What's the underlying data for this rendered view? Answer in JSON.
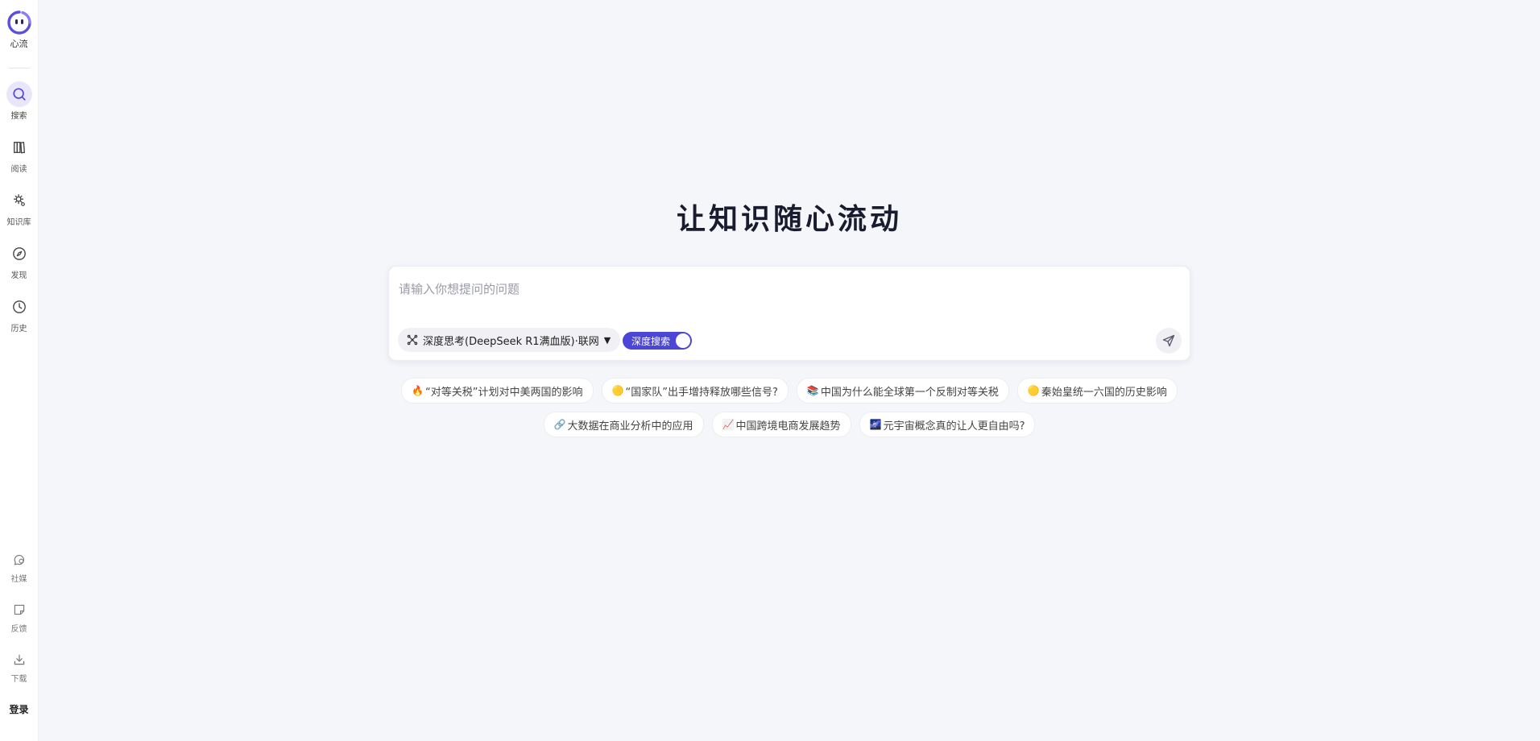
{
  "brand": {
    "name": "心流"
  },
  "sidebar": {
    "items": [
      {
        "label": "搜索",
        "icon": "search-icon",
        "active": true
      },
      {
        "label": "阅读",
        "icon": "book-icon",
        "active": false
      },
      {
        "label": "知识库",
        "icon": "knowledge-icon",
        "active": false
      },
      {
        "label": "发现",
        "icon": "compass-icon",
        "active": false
      },
      {
        "label": "历史",
        "icon": "clock-icon",
        "active": false
      }
    ],
    "bottom_items": [
      {
        "label": "社媒",
        "icon": "chat-icon"
      },
      {
        "label": "反馈",
        "icon": "note-icon"
      },
      {
        "label": "下载",
        "icon": "download-icon"
      }
    ],
    "login_label": "登录"
  },
  "main": {
    "headline": "让知识随心流动",
    "search": {
      "placeholder": "请输入你想提问的问题",
      "model_label": "深度思考(DeepSeek R1满血版)·联网",
      "toggle_label": "深度搜索",
      "toggle_on": true
    },
    "suggestions_row1": [
      {
        "icon": "🔥",
        "text": "“对等关税”计划对中美两国的影响"
      },
      {
        "icon": "🟡",
        "text": "“国家队”出手增持释放哪些信号?"
      },
      {
        "icon": "📚",
        "text": "中国为什么能全球第一个反制对等关税"
      },
      {
        "icon": "🟡",
        "text": "秦始皇统一六国的历史影响"
      }
    ],
    "suggestions_row2": [
      {
        "icon": "🔗",
        "text": "大数据在商业分析中的应用"
      },
      {
        "icon": "📈",
        "text": "中国跨境电商发展趋势"
      },
      {
        "icon": "🌌",
        "text": "元宇宙概念真的让人更自由吗?"
      }
    ]
  },
  "colors": {
    "accent": "#4c46d6",
    "background": "#f5f6fa",
    "active_nav_bg": "#e9e6fb"
  }
}
